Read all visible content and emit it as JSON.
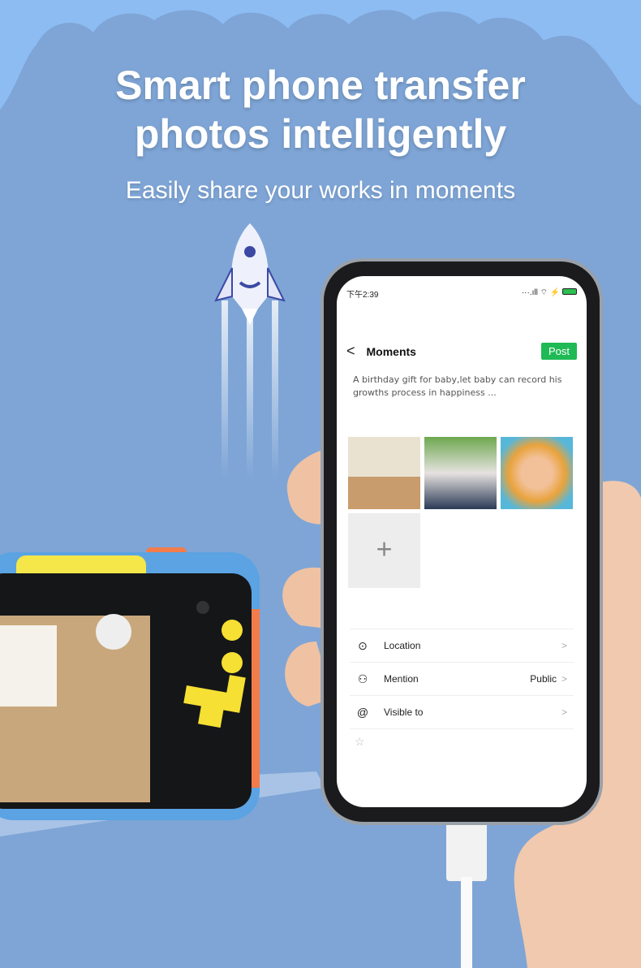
{
  "headline": [
    "Smart phone transfer",
    "photos intelligently"
  ],
  "subheadline": "Easily share your works in moments",
  "colors": {
    "background": "#7ea5d6",
    "cloud": "#8dbcf3",
    "post_button": "#1fb955"
  },
  "phone": {
    "status": {
      "time": "下午2:39",
      "icons": [
        "signal-icon",
        "wifi-icon",
        "charging-icon",
        "battery-icon"
      ]
    },
    "nav": {
      "back": "<",
      "title": "Moments",
      "post": "Post"
    },
    "description": "A birthday gift for baby,let baby can record his growths process in happiness ...",
    "photos": [
      "child-drawing-photo",
      "two-kids-photo",
      "kids-circle-photo"
    ],
    "add_photo": "+",
    "options": [
      {
        "icon": "location-icon",
        "glyph": "⊙",
        "label": "Location",
        "value": ""
      },
      {
        "icon": "person-icon",
        "glyph": "⚇",
        "label": "Mention",
        "value": "Public"
      },
      {
        "icon": "at-icon",
        "glyph": "@",
        "label": "Visible to",
        "value": ""
      }
    ],
    "chevron": ">",
    "star": "☆"
  }
}
